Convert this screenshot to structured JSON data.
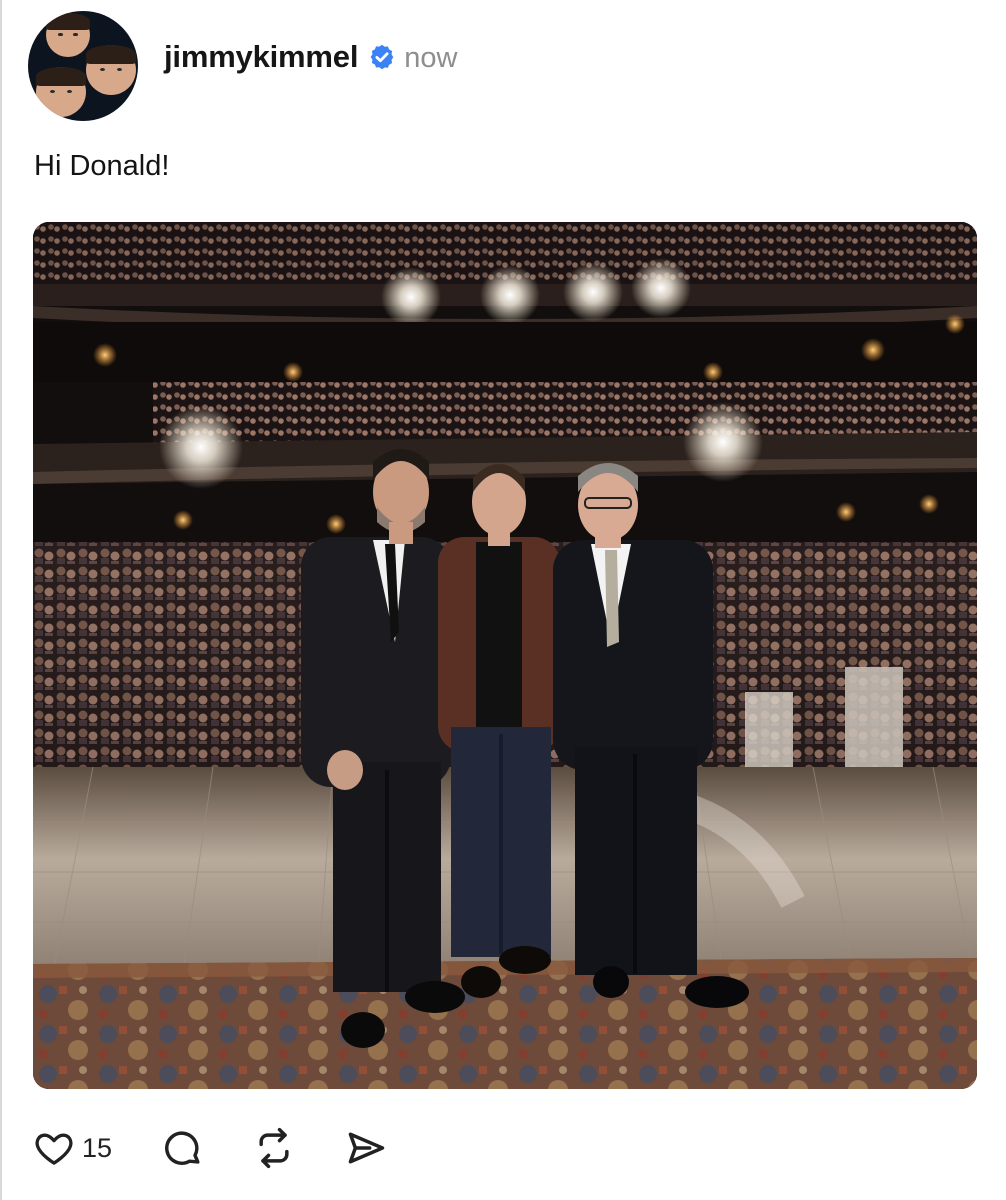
{
  "post": {
    "username": "jimmykimmel",
    "timestamp": "now",
    "text": "Hi Donald!",
    "verified_icon": "verified-badge-icon",
    "verified_color": "#3b82f6"
  },
  "media": {
    "type": "photo",
    "alt": ""
  },
  "actions": {
    "like_icon": "heart-icon",
    "like_count": "15",
    "comment_icon": "comment-icon",
    "repost_icon": "repost-icon",
    "share_icon": "send-icon"
  }
}
